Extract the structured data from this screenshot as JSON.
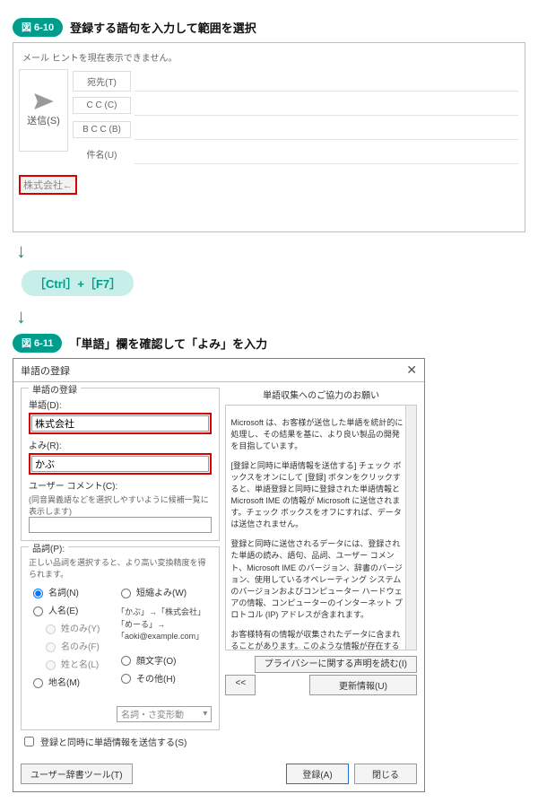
{
  "figure1": {
    "label": "図 6-10",
    "title": "登録する語句を入力して範囲を選択",
    "hint": "メール ヒントを現在表示できません。",
    "send_label": "送信(S)",
    "to_label": "宛先(T)",
    "cc_label": "C C (C)",
    "bcc_label": "B C C (B)",
    "subject_label": "件名(U)",
    "selected_word": "株式会社←"
  },
  "key_hint": "［Ctrl］+［F7］",
  "figure2": {
    "label": "図 6-11",
    "title": "「単語」欄を確認して「よみ」を入力"
  },
  "dialog": {
    "titlebar": "単語の登録",
    "group1_title": "単語の登録",
    "word_label": "単語(D):",
    "word_value": "株式会社",
    "yomi_label": "よみ(R):",
    "yomi_value": "かぶ",
    "comment_label": "ユーザー コメント(C):",
    "comment_hint": "(同音異義語などを選択しやすいように候補一覧に表示します)",
    "hinshi_title": "品詞(P):",
    "hinshi_hint": "正しい品詞を選択すると、より高い変換精度を得られます。",
    "radios": {
      "meishi": "名詞(N)",
      "jinmei": "人名(E)",
      "sei": "姓のみ(Y)",
      "mei": "名のみ(F)",
      "seimei": "姓と名(L)",
      "chimei": "地名(M)",
      "tanshuku": "短縮よみ(W)",
      "kaomoji": "顔文字(O)",
      "sonota": "その他(H)"
    },
    "conv_ex1": "「かぶ」→「株式会社」",
    "conv_ex2": "「めーる」→「aoki@example.com」",
    "select_placeholder": "名詞・さ変形動",
    "right_title": "単語収集へのご協力のお願い",
    "right_para1": "Microsoft は、お客様が送信した単語を統計的に処理し、その結果を基に、より良い製品の開発を目指しています。",
    "right_para2": "[登録と同時に単語情報を送信する] チェック ボックスをオンにして [登録] ボタンをクリックすると、単語登録と同時に登録された単語情報と Microsoft IME の情報が Microsoft に送信されます。チェック ボックスをオフにすれば、データは送信されません。",
    "right_para3": "登録と同時に送信されるデータには、登録された単語の読み、語句、品詞、ユーザー コメント、Microsoft IME のバージョン、辞書のバージョン、使用しているオペレーティング システムのバージョンおよびコンピューター ハードウェアの情報、コンピューターのインターネット プロトコル (IP) アドレスが含まれます。",
    "right_para4": "お客様特有の情報が収集されたデータに含まれることがあります。このような情報が存在する場合でも、Microsoft では、お客様を特定するために使用することはありませ",
    "privacy_btn": "プライバシーに関する声明を読む(I)",
    "chk_send": "登録と同時に単語情報を送信する(S)",
    "back_btn": "<<",
    "update_btn": "更新情報(U)",
    "tool_btn": "ユーザー辞書ツール(T)",
    "register_btn": "登録(A)",
    "close_btn_label": "閉じる"
  }
}
